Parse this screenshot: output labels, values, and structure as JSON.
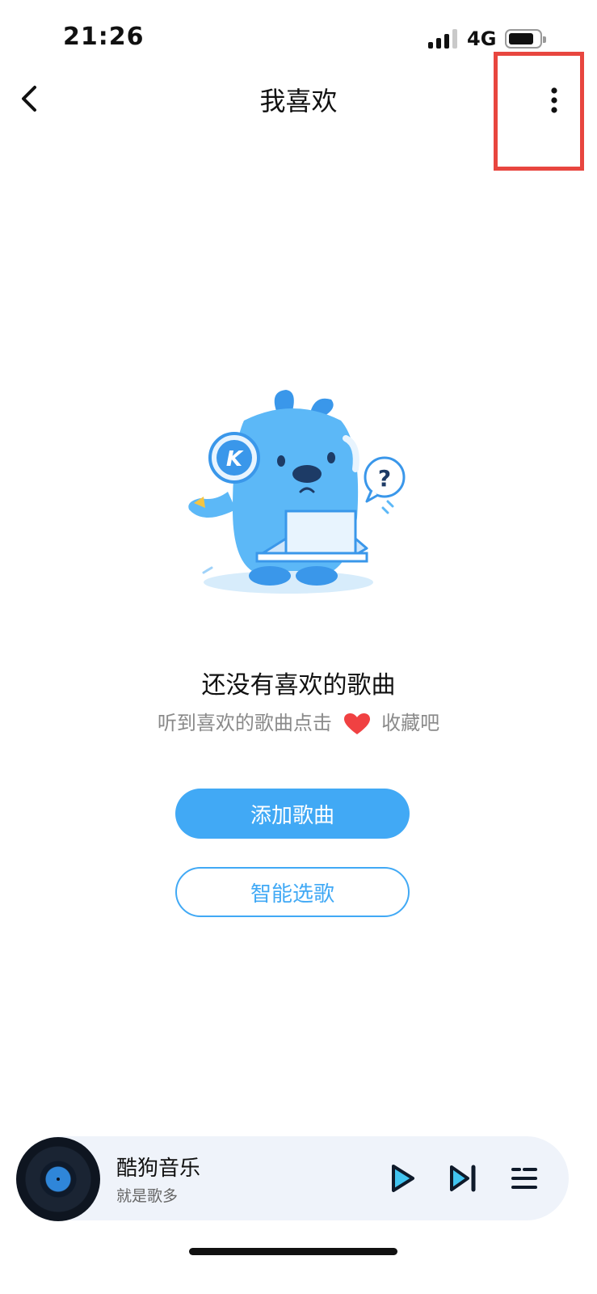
{
  "status_bar": {
    "time": "21:26",
    "network": "4G",
    "signal_bars_active": 3,
    "signal_bars_total": 4,
    "battery_level": 0.7
  },
  "nav": {
    "title": "我喜欢",
    "back_icon": "chevron-left-icon",
    "more_icon": "vertical-ellipsis-icon"
  },
  "empty_state": {
    "title": "还没有喜欢的歌曲",
    "hint_before": "听到喜欢的歌曲点击",
    "hint_after": "收藏吧",
    "heart_color": "#f04142",
    "illustration": "kugou-mascot-illustration"
  },
  "actions": {
    "add_songs": "添加歌曲",
    "smart_pick": "智能选歌"
  },
  "player": {
    "title": "酷狗音乐",
    "subtitle": "就是歌多",
    "play_icon": "play-icon",
    "next_icon": "next-track-icon",
    "playlist_icon": "playlist-icon"
  },
  "colors": {
    "accent": "#41a9f5",
    "highlight_box": "#e8463f",
    "player_bar_bg": "#eff3fa"
  }
}
